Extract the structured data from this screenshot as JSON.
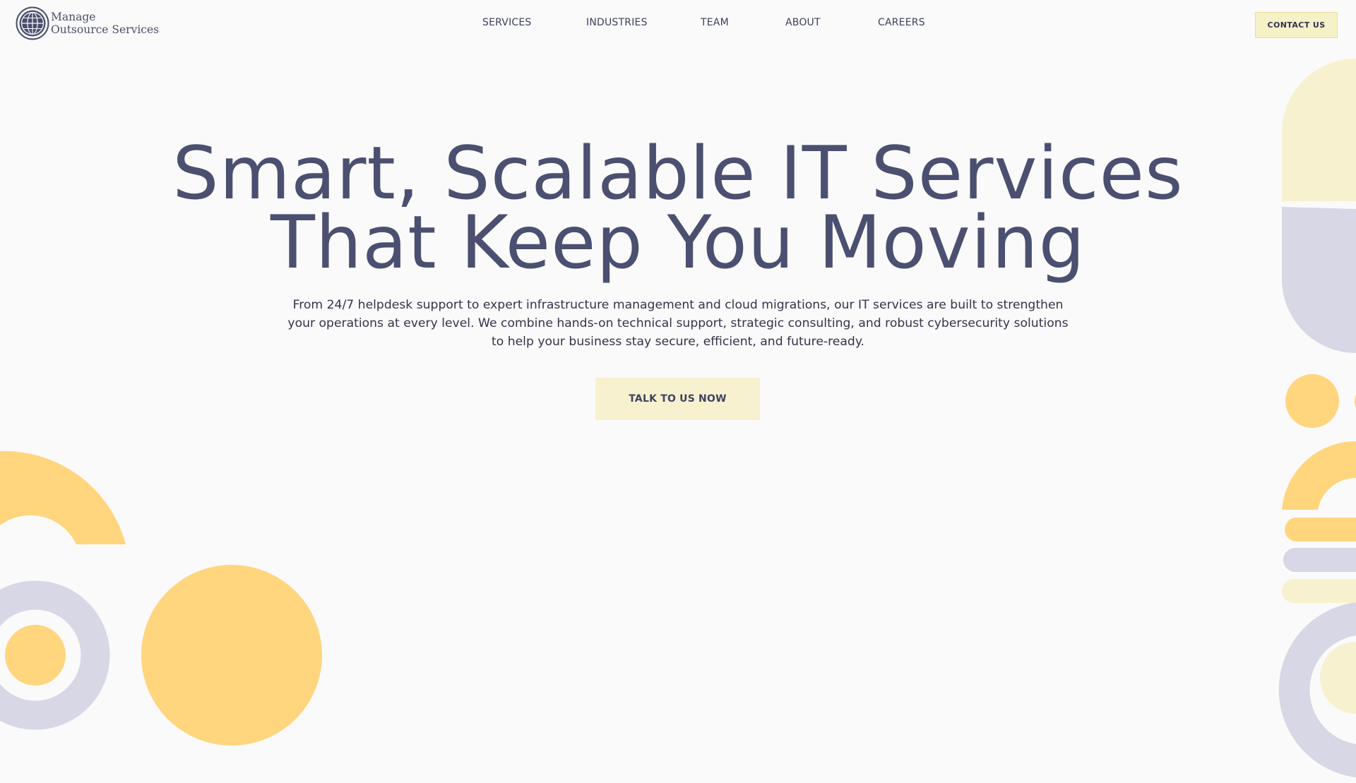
{
  "header": {
    "logo": {
      "line1": "Manage",
      "line2": "Outsource Services",
      "icon": "globe-icon"
    },
    "nav": {
      "items": [
        {
          "label": "SERVICES"
        },
        {
          "label": "INDUSTRIES"
        },
        {
          "label": "TEAM"
        },
        {
          "label": "ABOUT"
        },
        {
          "label": "CAREERS"
        }
      ]
    },
    "contact_label": "CONTACT US"
  },
  "hero": {
    "title_line1": "Smart, Scalable IT Services",
    "title_line2": "That Keep You Moving",
    "description": "From 24/7 helpdesk support to expert infrastructure management and cloud migrations, our IT services are built to strengthen your operations at every level. We combine hands-on technical support, strategic consulting, and robust cybersecurity solutions to help your business stay secure, efficient, and future-ready.",
    "cta_label": "TALK TO US NOW"
  },
  "colors": {
    "background": "#fafafa",
    "text_primary": "#4b4f70",
    "accent_yellow": "#ffd57e",
    "accent_cream": "#f7f1cf",
    "accent_lavender": "#d7d7e5"
  }
}
